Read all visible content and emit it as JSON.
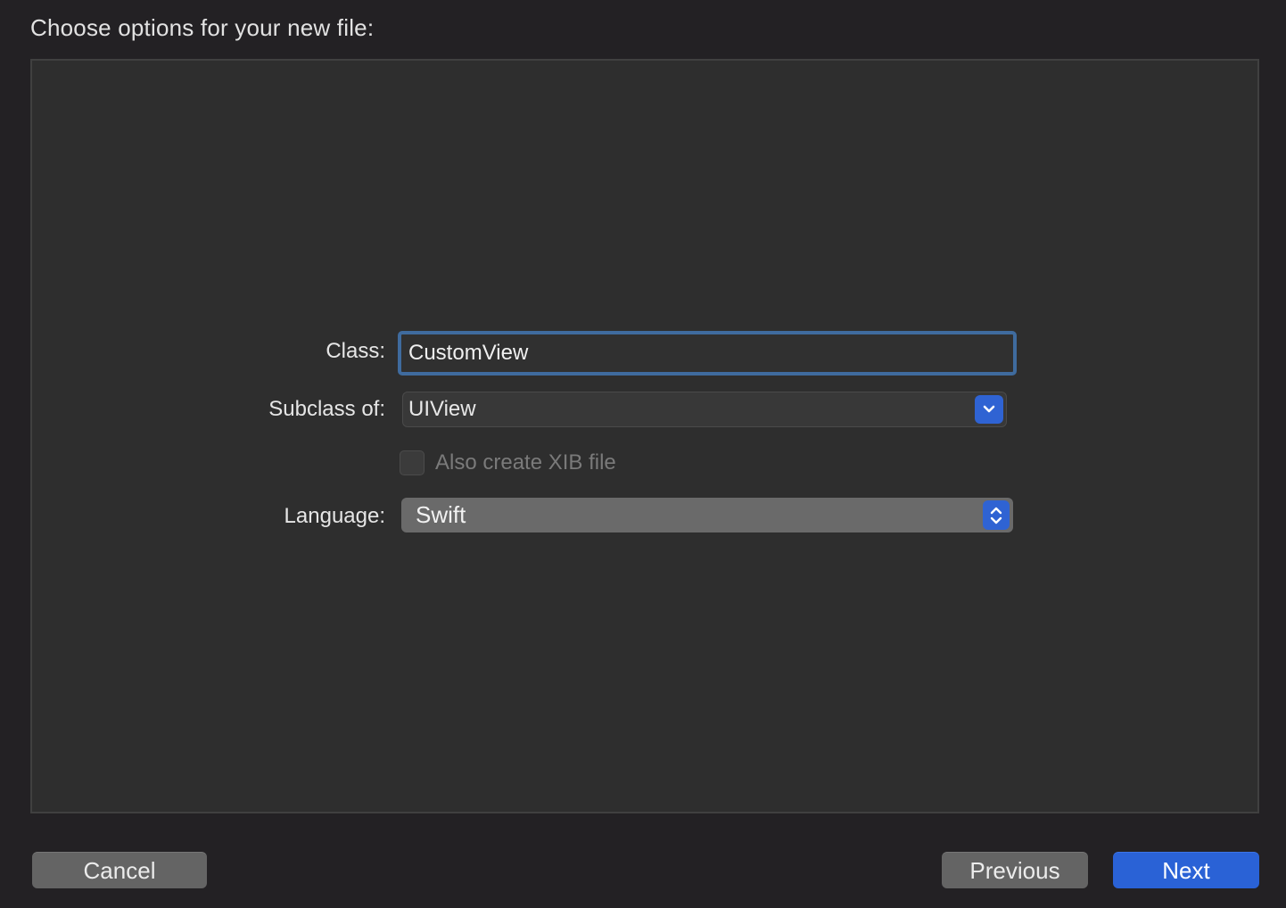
{
  "dialog": {
    "heading": "Choose options for your new file:"
  },
  "form": {
    "class_label": "Class:",
    "class_value": "CustomView",
    "subclass_label": "Subclass of:",
    "subclass_value": "UIView",
    "xib_label": "Also create XIB file",
    "xib_checked": false,
    "xib_enabled": false,
    "language_label": "Language:",
    "language_value": "Swift"
  },
  "footer": {
    "cancel_label": "Cancel",
    "previous_label": "Previous",
    "next_label": "Next"
  },
  "colors": {
    "accent": "#2a62d6",
    "focus_ring": "#3f6b9e",
    "background": "#232124",
    "panel": "#2e2e2e"
  },
  "icons": {
    "subclass_popup": "chevron-down-icon",
    "language_popup": "up-down-chevron-icon"
  }
}
